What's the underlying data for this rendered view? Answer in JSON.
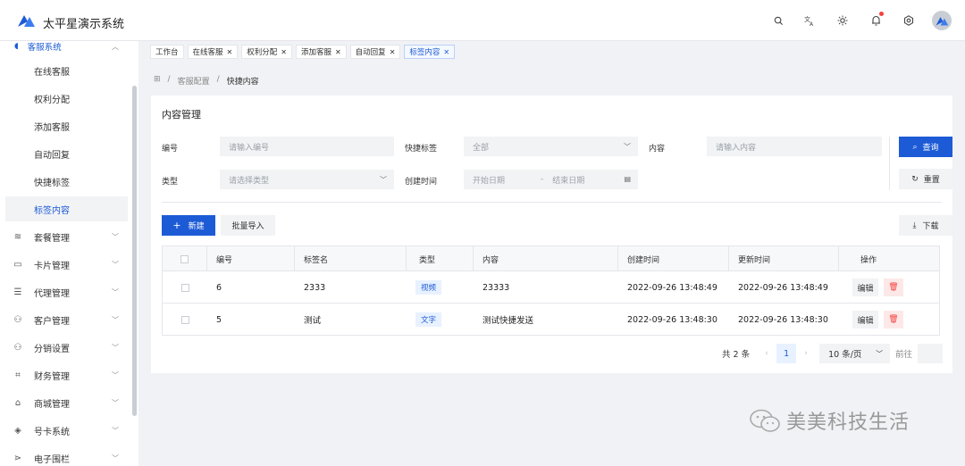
{
  "header": {
    "title": "太平星演示系统",
    "brand_color": "#1d5bd6"
  },
  "sidebar": {
    "group": {
      "label": "客服系统",
      "open": true
    },
    "sub_items": [
      {
        "label": "在线客服"
      },
      {
        "label": "权利分配"
      },
      {
        "label": "添加客服"
      },
      {
        "label": "自动回复"
      },
      {
        "label": "快捷标签"
      },
      {
        "label": "标签内容",
        "active": true
      }
    ],
    "items": [
      {
        "label": "套餐管理",
        "icon": "layers-icon"
      },
      {
        "label": "卡片管理",
        "icon": "folder-icon"
      },
      {
        "label": "代理管理",
        "icon": "list-icon"
      },
      {
        "label": "客户管理",
        "icon": "users-icon"
      },
      {
        "label": "分销设置",
        "icon": "user-group-icon"
      },
      {
        "label": "财务管理",
        "icon": "scan-icon"
      },
      {
        "label": "商城管理",
        "icon": "shop-icon"
      },
      {
        "label": "号卡系统",
        "icon": "cube-icon"
      },
      {
        "label": "电子围栏",
        "icon": "share-icon"
      }
    ]
  },
  "tabs": [
    {
      "label": "工作台",
      "closable": false
    },
    {
      "label": "在线客服",
      "closable": true
    },
    {
      "label": "权利分配",
      "closable": true
    },
    {
      "label": "添加客服",
      "closable": true
    },
    {
      "label": "自动回复",
      "closable": true
    },
    {
      "label": "标签内容",
      "closable": true,
      "active": true
    }
  ],
  "breadcrumb": {
    "home_icon": "apps-icon",
    "sep": "/",
    "level1": "客服配置",
    "current": "快捷内容"
  },
  "card": {
    "title": "内容管理",
    "form": {
      "id_label": "编号",
      "id_placeholder": "请输入编号",
      "tag_label": "快捷标签",
      "tag_value": "全部",
      "content_label": "内容",
      "content_placeholder": "请输入内容",
      "type_label": "类型",
      "type_placeholder": "请选择类型",
      "created_label": "创建时间",
      "start_placeholder": "开始日期",
      "range_sep": "-",
      "end_placeholder": "结束日期"
    },
    "buttons": {
      "search": "查询",
      "reset": "重置",
      "new": "新建",
      "import": "批量导入",
      "download": "下载"
    },
    "table": {
      "columns": [
        "编号",
        "标签名",
        "类型",
        "内容",
        "创建时间",
        "更新时间",
        "操作"
      ],
      "rows": [
        {
          "id": "6",
          "tag": "2333",
          "type": "视频",
          "content": "23333",
          "created": "2022-09-26 13:48:49",
          "updated": "2022-09-26 13:48:49",
          "edit": "编辑"
        },
        {
          "id": "5",
          "tag": "测试",
          "type": "文字",
          "content": "测试快捷发送",
          "created": "2022-09-26 13:48:30",
          "updated": "2022-09-26 13:48:30",
          "edit": "编辑"
        }
      ]
    },
    "pagination": {
      "total": "共 2 条",
      "current_page": "1",
      "page_size": "10 条/页",
      "goto_label": "前往"
    }
  },
  "watermark": {
    "text": "美美科技生活"
  }
}
